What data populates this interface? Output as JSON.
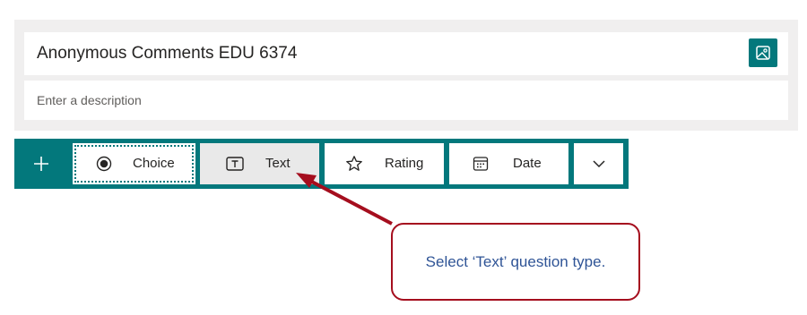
{
  "form": {
    "title": "Anonymous Comments EDU 6374",
    "description_placeholder": "Enter a description",
    "image_icon": "image-icon"
  },
  "toolbar": {
    "add_icon": "plus-icon",
    "question_types": [
      {
        "label": "Choice",
        "icon": "radio-icon"
      },
      {
        "label": "Text",
        "icon": "text-box-icon"
      },
      {
        "label": "Rating",
        "icon": "star-icon"
      },
      {
        "label": "Date",
        "icon": "calendar-icon"
      }
    ],
    "more_icon": "chevron-down-icon"
  },
  "callout": {
    "text": "Select ‘Text’ question type.",
    "border_color": "#a50e1e",
    "text_color": "#2f5496"
  },
  "colors": {
    "accent": "#03787c",
    "header_bg": "#f0efef",
    "arrow": "#a50e1e"
  }
}
